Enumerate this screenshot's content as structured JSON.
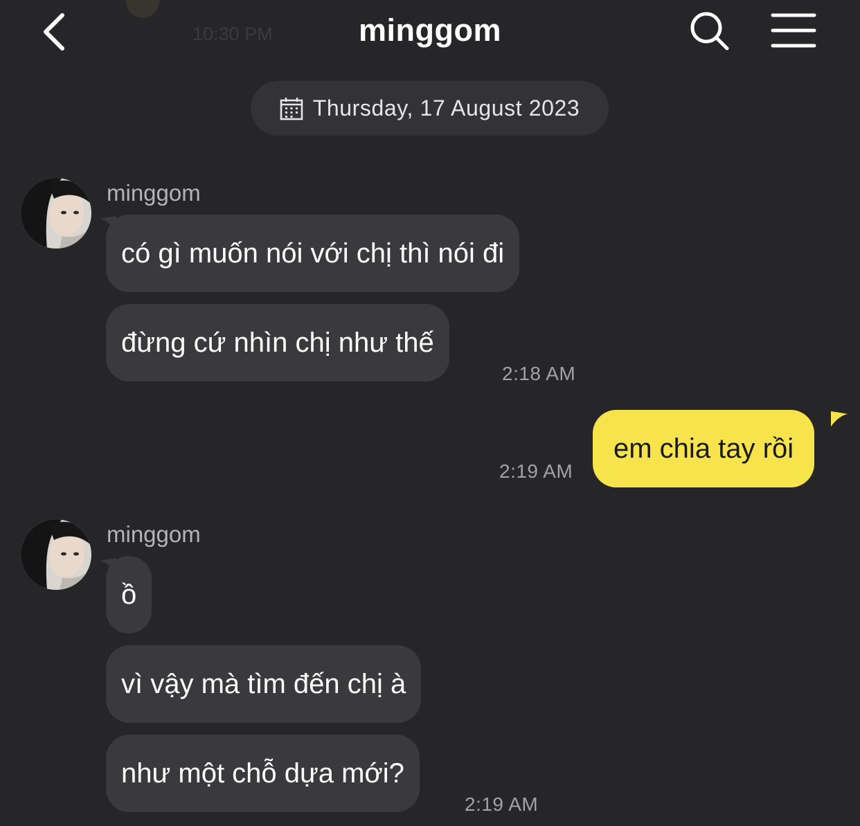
{
  "header": {
    "title": "minggom",
    "ghost_time": "10:30 PM",
    "icons": {
      "back": "chevron-left-icon",
      "search": "search-icon",
      "menu": "menu-icon"
    }
  },
  "date_divider": {
    "icon": "calendar-icon",
    "label": "Thursday, 17 August 2023"
  },
  "colors": {
    "background": "#262629",
    "incoming_bubble": "#3a3a3d",
    "outgoing_bubble": "#f7e44c",
    "timestamp": "#a3a3a3"
  },
  "messages": {
    "group1": {
      "sender": "minggom",
      "bubbles": [
        "có gì muốn nói với chị thì nói đi",
        "đừng cứ nhìn chị như thế"
      ],
      "time": "2:18 AM"
    },
    "mine1": {
      "text": "em chia tay rồi",
      "time": "2:19 AM"
    },
    "group2": {
      "sender": "minggom",
      "bubbles": [
        "ồ",
        "vì vậy mà tìm đến chị à",
        "như một chỗ dựa mới?"
      ],
      "time": "2:19 AM"
    }
  }
}
